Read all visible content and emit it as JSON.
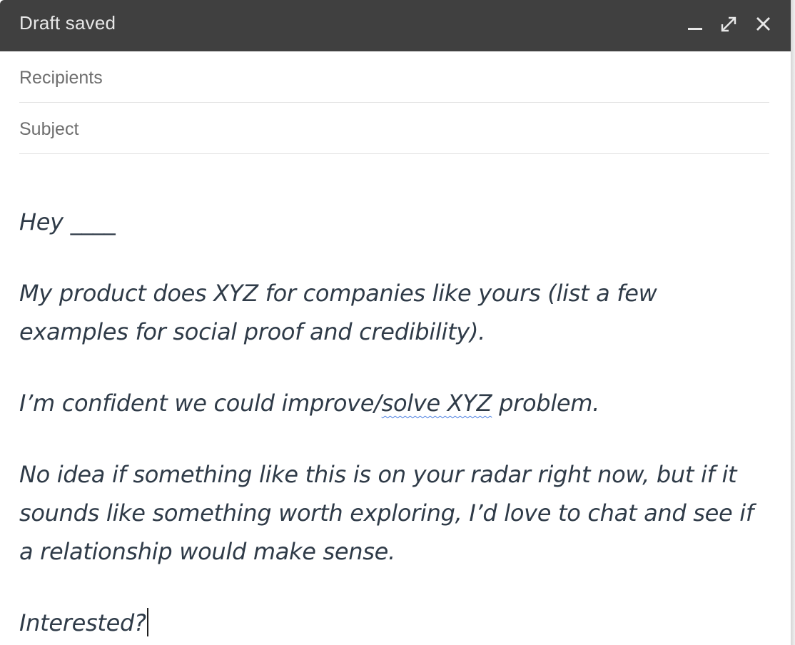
{
  "window": {
    "title": "Draft saved",
    "controls": {
      "minimize_icon": "minimize-icon",
      "expand_icon": "expand-icon",
      "close_icon": "close-icon"
    }
  },
  "fields": {
    "recipients_placeholder": "Recipients",
    "subject_placeholder": "Subject"
  },
  "body": {
    "greeting": "Hey ____",
    "para1": "My product does XYZ for companies like yours (list a few\nexamples for social proof and credibility).",
    "para2_before": "I’m confident we could improve/",
    "para2_flagged": "solve XYZ",
    "para2_after": " problem.",
    "para3": "No idea if something like this is on your radar right now, but if it\nsounds like something worth exploring, I’d love to chat and see if\na relationship would make sense.",
    "closing": "Interested?"
  },
  "colors": {
    "titlebar": "#404040",
    "title_text": "#e8e8e8",
    "body_text": "#2f3b48",
    "spellcheck": "#4a7fe0"
  }
}
